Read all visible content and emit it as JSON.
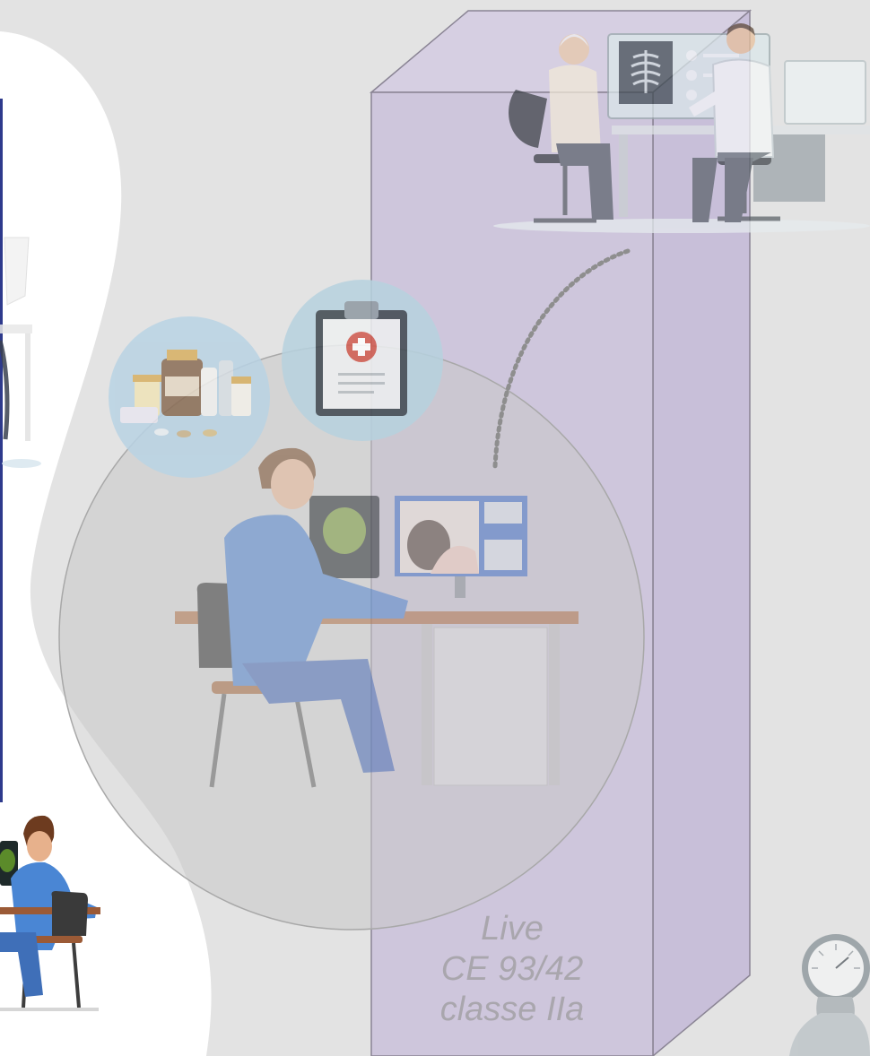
{
  "colors": {
    "background": "#e3e3e3",
    "prism_front": "#cec6dc",
    "prism_edge": "#8a8494",
    "circle": "#cfcfcf",
    "accent_blue": "#4a76c9",
    "badge_blue": "#b9d3e4"
  },
  "icons": [
    "doctor-patient-consult-icon",
    "medicine-bottles-icon",
    "medical-clipboard-icon",
    "doctor-at-computer-icon",
    "blood-pressure-gauge-icon"
  ],
  "label": {
    "line1": "Live",
    "line2": "CE 93/42",
    "line3": "classe IIa"
  }
}
